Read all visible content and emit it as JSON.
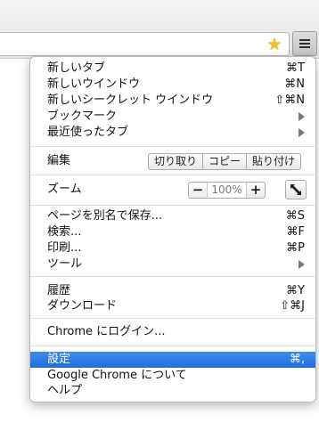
{
  "toolbar": {
    "star_icon": "star-icon",
    "menu_icon": "hamburger-menu-icon"
  },
  "menu": {
    "group1": [
      {
        "label": "新しいタブ",
        "shortcut": "⌘T"
      },
      {
        "label": "新しいウインドウ",
        "shortcut": "⌘N"
      },
      {
        "label": "新しいシークレット ウインドウ",
        "shortcut": "⇧⌘N"
      },
      {
        "label": "ブックマーク",
        "shortcut": ""
      },
      {
        "label": "最近使ったタブ",
        "shortcut": ""
      }
    ],
    "edit": {
      "label": "編集",
      "cut": "切り取り",
      "copy": "コピー",
      "paste": "貼り付け"
    },
    "zoom": {
      "label": "ズーム",
      "minus": "−",
      "value": "100%",
      "plus": "+"
    },
    "group3": [
      {
        "label": "ページを別名で保存...",
        "shortcut": "⌘S"
      },
      {
        "label": "検索...",
        "shortcut": "⌘F"
      },
      {
        "label": "印刷...",
        "shortcut": "⌘P"
      },
      {
        "label": "ツール",
        "shortcut": ""
      }
    ],
    "group4": [
      {
        "label": "履歴",
        "shortcut": "⌘Y"
      },
      {
        "label": "ダウンロード",
        "shortcut": "⇧⌘J"
      }
    ],
    "signin": {
      "label": "Chrome にログイン..."
    },
    "group5": [
      {
        "label": "設定",
        "shortcut": "⌘,"
      },
      {
        "label": "Google Chrome について",
        "shortcut": ""
      },
      {
        "label": "ヘルプ",
        "shortcut": ""
      }
    ]
  },
  "colors": {
    "selection": "#2f7ceb",
    "star": "#f2bf2a"
  }
}
